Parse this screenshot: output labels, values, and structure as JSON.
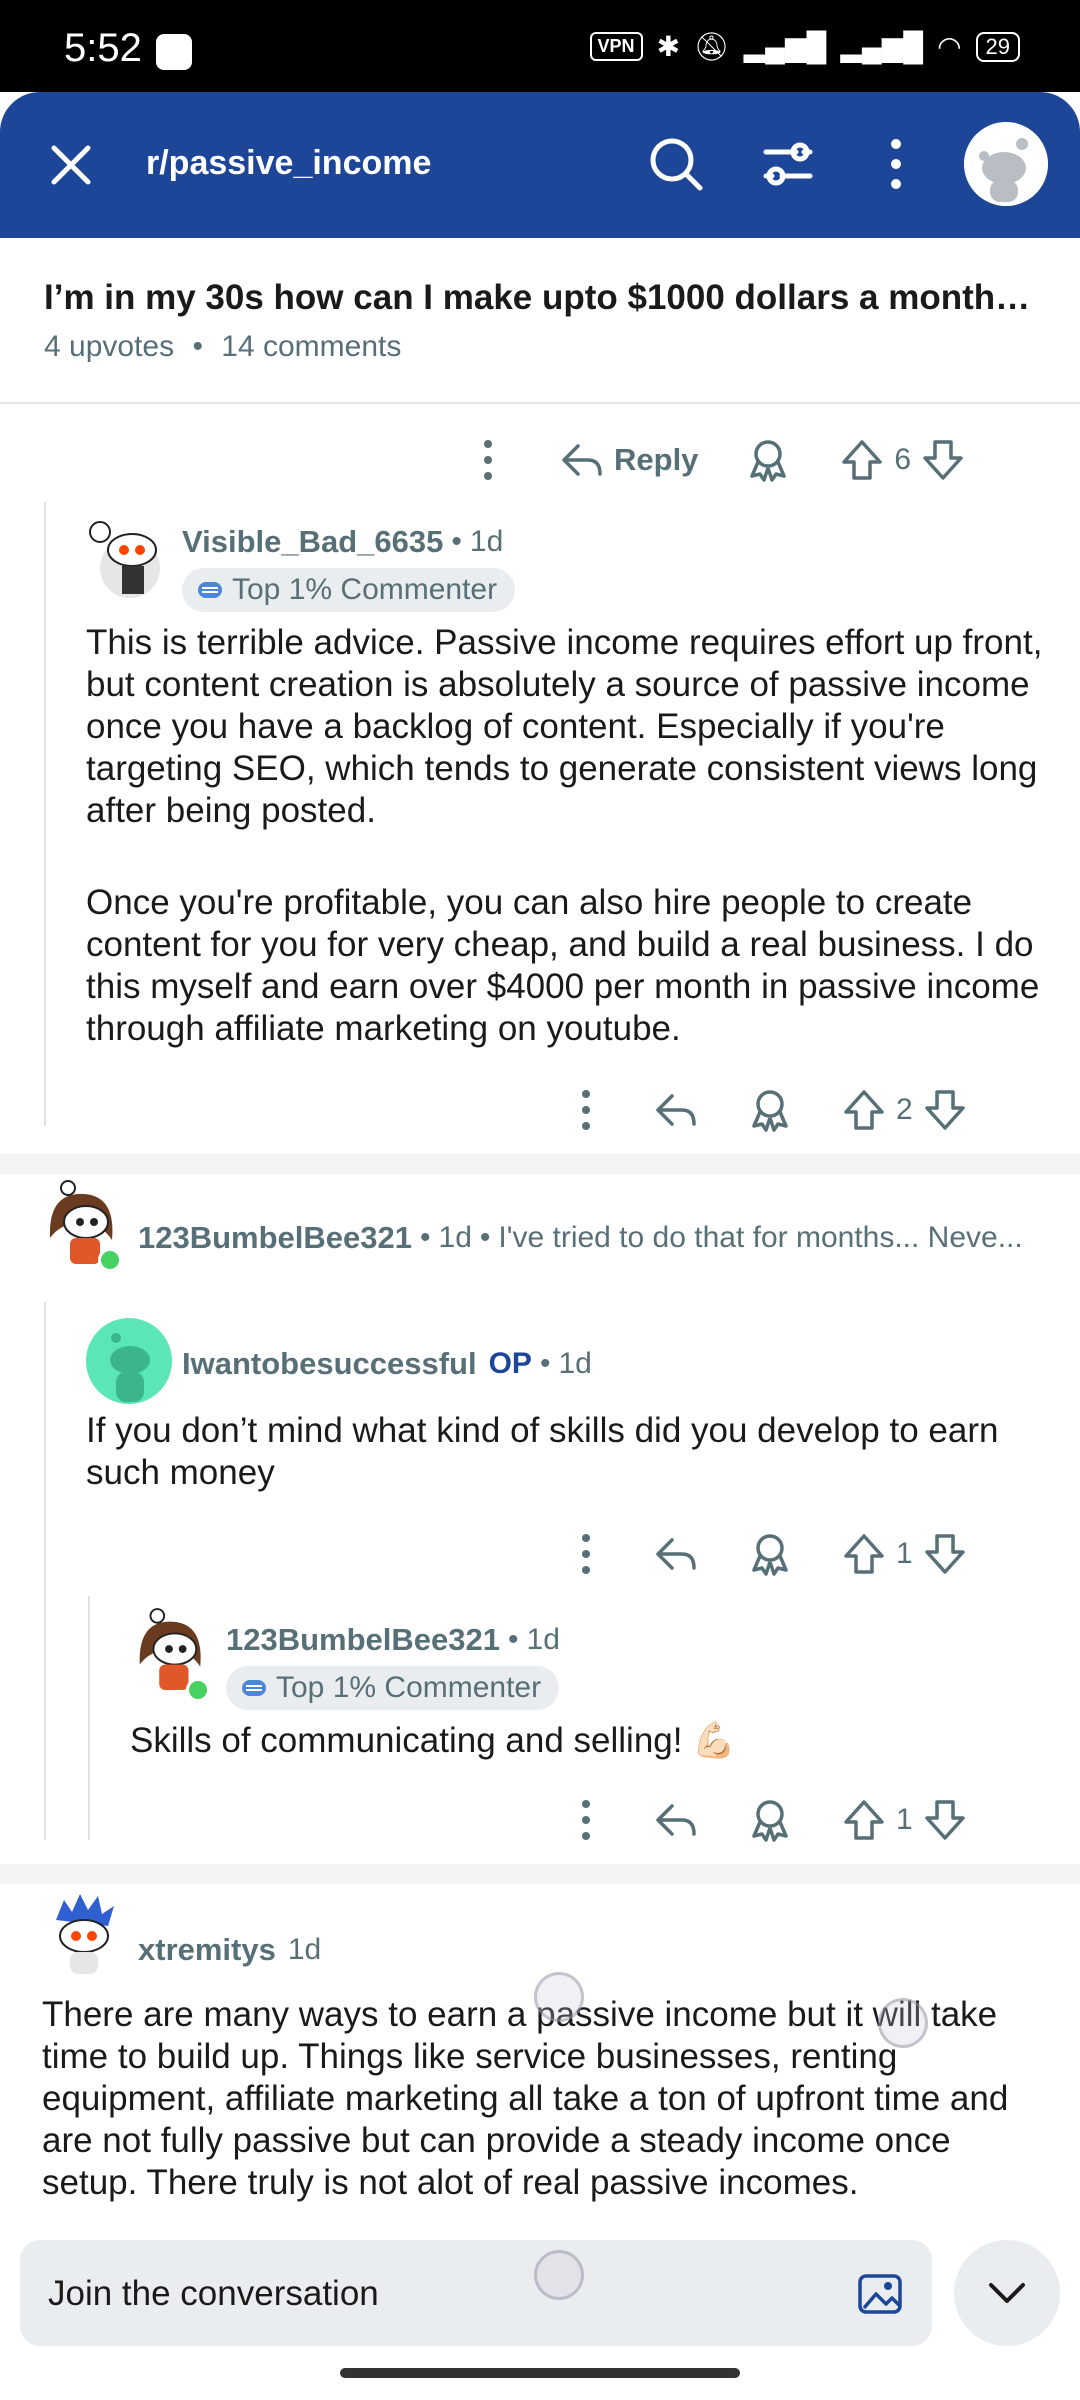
{
  "status_bar": {
    "time": "5:52",
    "vpn": "VPN",
    "battery": "29"
  },
  "header": {
    "subreddit": "r/passive_income"
  },
  "post": {
    "title": "I’m in my 30s how can I make upto $1000 dollars a month p...",
    "upvotes": "4 upvotes",
    "bullet": "•",
    "comments": "14 comments"
  },
  "top_actions": {
    "reply_label": "Reply",
    "votes": "6"
  },
  "comments": [
    {
      "username": "Visible_Bad_6635",
      "dot": "•",
      "age": "1d",
      "badge": "Top 1% Commenter",
      "body_p1": "This is terrible advice. Passive income requires effort up front, but content creation is absolutely a source of passive income once you have a backlog of content. Especially if you're targeting SEO, which tends to generate consistent views long after being posted.",
      "body_p2": "Once you're profitable, you can also hire people to create content for you for very cheap, and build a real business. I do this myself and earn over $4000 per month in passive income through affiliate marketing on youtube.",
      "votes": "2"
    },
    {
      "username": "123BumbelBee321",
      "dot": "•",
      "age": "1d",
      "dot2": "•",
      "preview": "I've tried to do that for months... Neve..."
    },
    {
      "username": "Iwantobesuccessful",
      "op": "OP",
      "dot": "•",
      "age": "1d",
      "body": "If you don’t mind what kind of skills did you develop to earn such money",
      "votes": "1"
    },
    {
      "username": "123BumbelBee321",
      "dot": "•",
      "age": "1d",
      "badge": "Top 1% Commenter",
      "body": "Skills of communicating and selling! 💪🏻",
      "votes": "1"
    },
    {
      "username": "xtremitys",
      "age": "1d",
      "body": "There are many ways to earn a passive income but it will take time to build up. Things like service businesses, renting equipment, affiliate marketing all take a ton of upfront time and are not fully passive but can provide a steady income once setup. There truly is not alot of real passive incomes."
    }
  ],
  "composer": {
    "placeholder": "Join the conversation"
  },
  "colors": {
    "header_bg": "#1d4699",
    "meta_text": "#576f76",
    "online": "#46d160"
  }
}
